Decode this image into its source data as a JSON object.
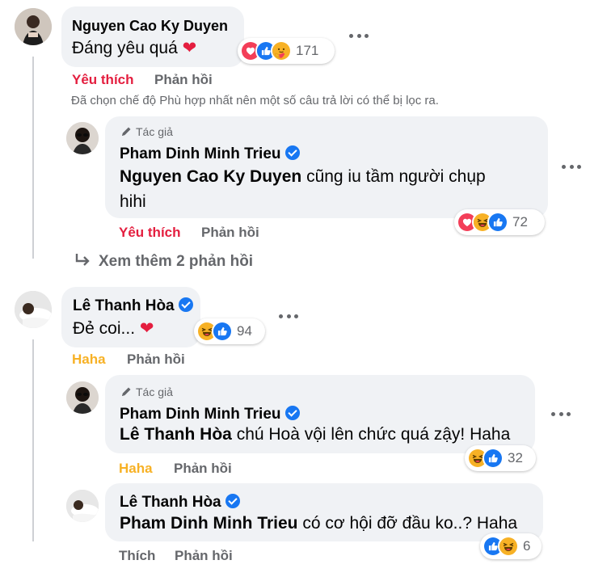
{
  "colors": {
    "like_active": "#e41e3f",
    "haha_active": "#f7b125",
    "verified": "#1877f2",
    "bubble": "#f0f2f5"
  },
  "actions": {
    "like": "Yêu thích",
    "reply": "Phản hồi",
    "haha": "Haha",
    "thich": "Thích"
  },
  "author_badge": "Tác giả",
  "comments": [
    {
      "author": "Nguyen Cao Ky Duyen",
      "text": "Đáng yêu quá",
      "reactions": [
        "love-icon",
        "like-icon",
        "care-icon"
      ],
      "count": "171",
      "active_action": "Yêu thích"
    },
    {
      "author": "Pham Dinh Minh Trieu",
      "mention": "Nguyen Cao Ky Duyen",
      "text_line1": "cũng iu tầm người chụp",
      "text_line2": "hihi",
      "reactions": [
        "love-icon",
        "haha-icon",
        "like-icon"
      ],
      "count": "72",
      "active_action": "Yêu thích"
    },
    {
      "author": "Lê Thanh Hòa",
      "text": "Đẻ coi...",
      "reactions": [
        "haha-icon",
        "like-icon"
      ],
      "count": "94",
      "active_action": "Haha"
    },
    {
      "author": "Pham Dinh Minh Trieu",
      "mention": "Lê Thanh Hòa",
      "text": "chú Hoà vội lên chức quá zậy! Haha",
      "reactions": [
        "haha-icon",
        "like-icon"
      ],
      "count": "32",
      "active_action": "Haha"
    },
    {
      "author": "Lê Thanh Hòa",
      "mention": "Pham Dinh Minh Trieu",
      "text": "có cơ hội đỡ đầu ko..? Haha",
      "reactions": [
        "like-icon",
        "haha-icon"
      ],
      "count": "6",
      "active_action": "Thích"
    }
  ],
  "filter_notice": "Đã chọn chế độ Phù hợp nhất nên một số câu trả lời có thể bị lọc ra.",
  "see_more": "Xem thêm 2 phản hồi"
}
